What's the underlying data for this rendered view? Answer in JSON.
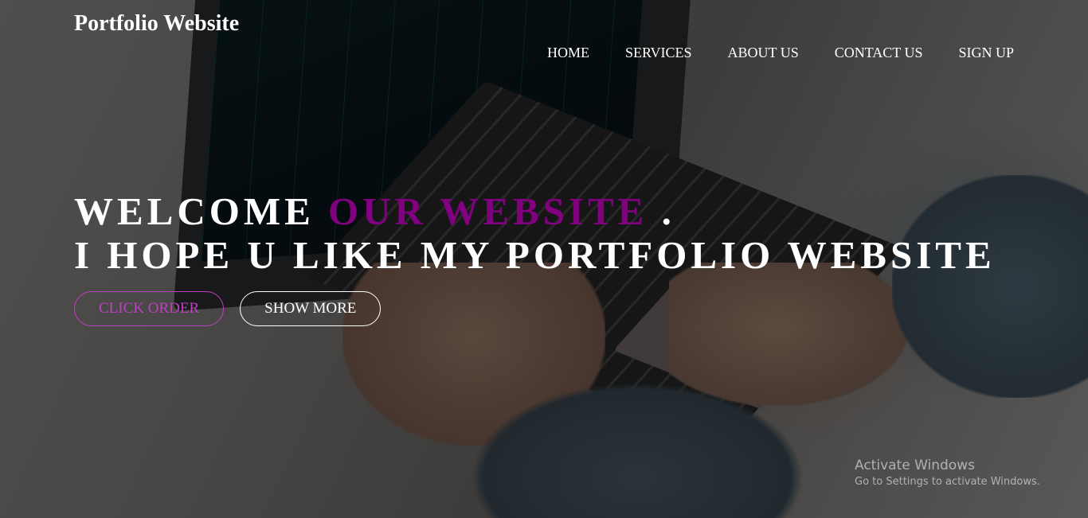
{
  "header": {
    "brand": "Portfolio Website",
    "nav": [
      "HOME",
      "SERVICES",
      "ABOUT US",
      "CONTACT US",
      "SIGN UP"
    ]
  },
  "hero": {
    "line1_part1": "WELCOME ",
    "line1_accent": "OUR WEBSITE",
    "line1_part2": " .",
    "line2": "I HOPE U LIKE MY PORTFOLIO WEBSITE",
    "buttons": {
      "order": "CLICK ORDER",
      "more": "SHOW MORE"
    }
  },
  "watermark": {
    "title": "Activate Windows",
    "subtitle": "Go to Settings to activate Windows."
  },
  "colors": {
    "accent": "#800080",
    "order_button": "#bf40bf",
    "text": "#ffffff"
  }
}
